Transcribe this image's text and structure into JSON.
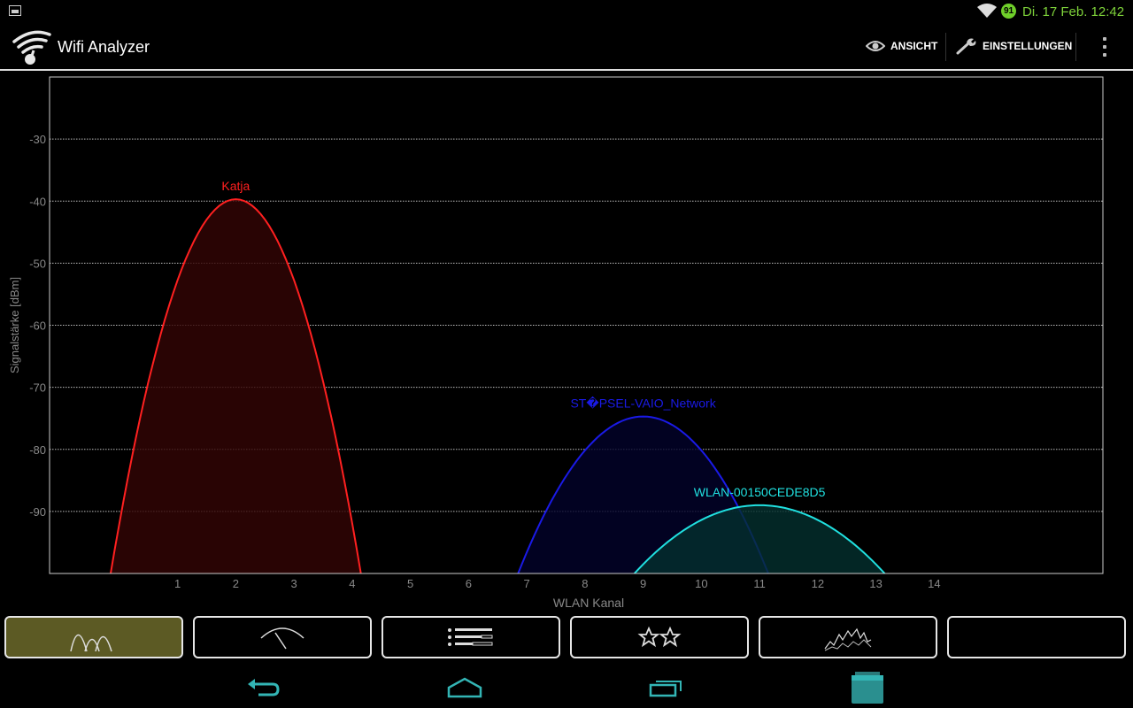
{
  "statusbar": {
    "clock": "Di. 17 Feb. 12:42",
    "battery_level": "91",
    "colors": {
      "clock": "#7ed23a",
      "battery": "#6fcf2a"
    }
  },
  "actionbar": {
    "app_icon": "wifi-logo-icon",
    "title": "Wifi Analyzer",
    "view_label": "ANSICHT",
    "settings_label": "EINSTELLUNGEN"
  },
  "chart_data": {
    "type": "area",
    "title": "",
    "xlabel": "WLAN Kanal",
    "ylabel": "Signalstärke [dBm]",
    "ylim": [
      -100,
      -20
    ],
    "xlim": [
      -1.2,
      16.9
    ],
    "x_ticks": [
      1,
      2,
      3,
      4,
      5,
      6,
      7,
      8,
      9,
      10,
      11,
      12,
      13,
      14
    ],
    "y_ticks": [
      -30,
      -40,
      -50,
      -60,
      -70,
      -80,
      -90
    ],
    "grid": true,
    "series": [
      {
        "name": "Katja",
        "channel": 2,
        "peak": -39.7,
        "width_channels": 4.3,
        "color": "#ff2020",
        "fill": "#330505"
      },
      {
        "name": "ST�PSEL-VAIO_Network",
        "channel": 9,
        "peak": -74.7,
        "width_channels": 4.3,
        "color": "#1a1ae6",
        "fill": "#02022a"
      },
      {
        "name": "WLAN-00150CEDE8D5",
        "channel": 11,
        "peak": -89.0,
        "width_channels": 4.3,
        "color": "#20e0e0",
        "fill": "#04302e"
      }
    ]
  },
  "tabs": [
    {
      "icon": "channel-graph-icon",
      "active": true
    },
    {
      "icon": "signal-meter-icon",
      "active": false
    },
    {
      "icon": "ap-list-icon",
      "active": false
    },
    {
      "icon": "channel-rating-icon",
      "active": false
    },
    {
      "icon": "time-graph-icon",
      "active": false
    },
    {
      "icon": "",
      "active": false
    }
  ],
  "navbar": {
    "buttons": [
      "back-icon",
      "home-icon",
      "recent-apps-icon",
      "app-drawer-icon"
    ],
    "color": "#33b5b5"
  }
}
